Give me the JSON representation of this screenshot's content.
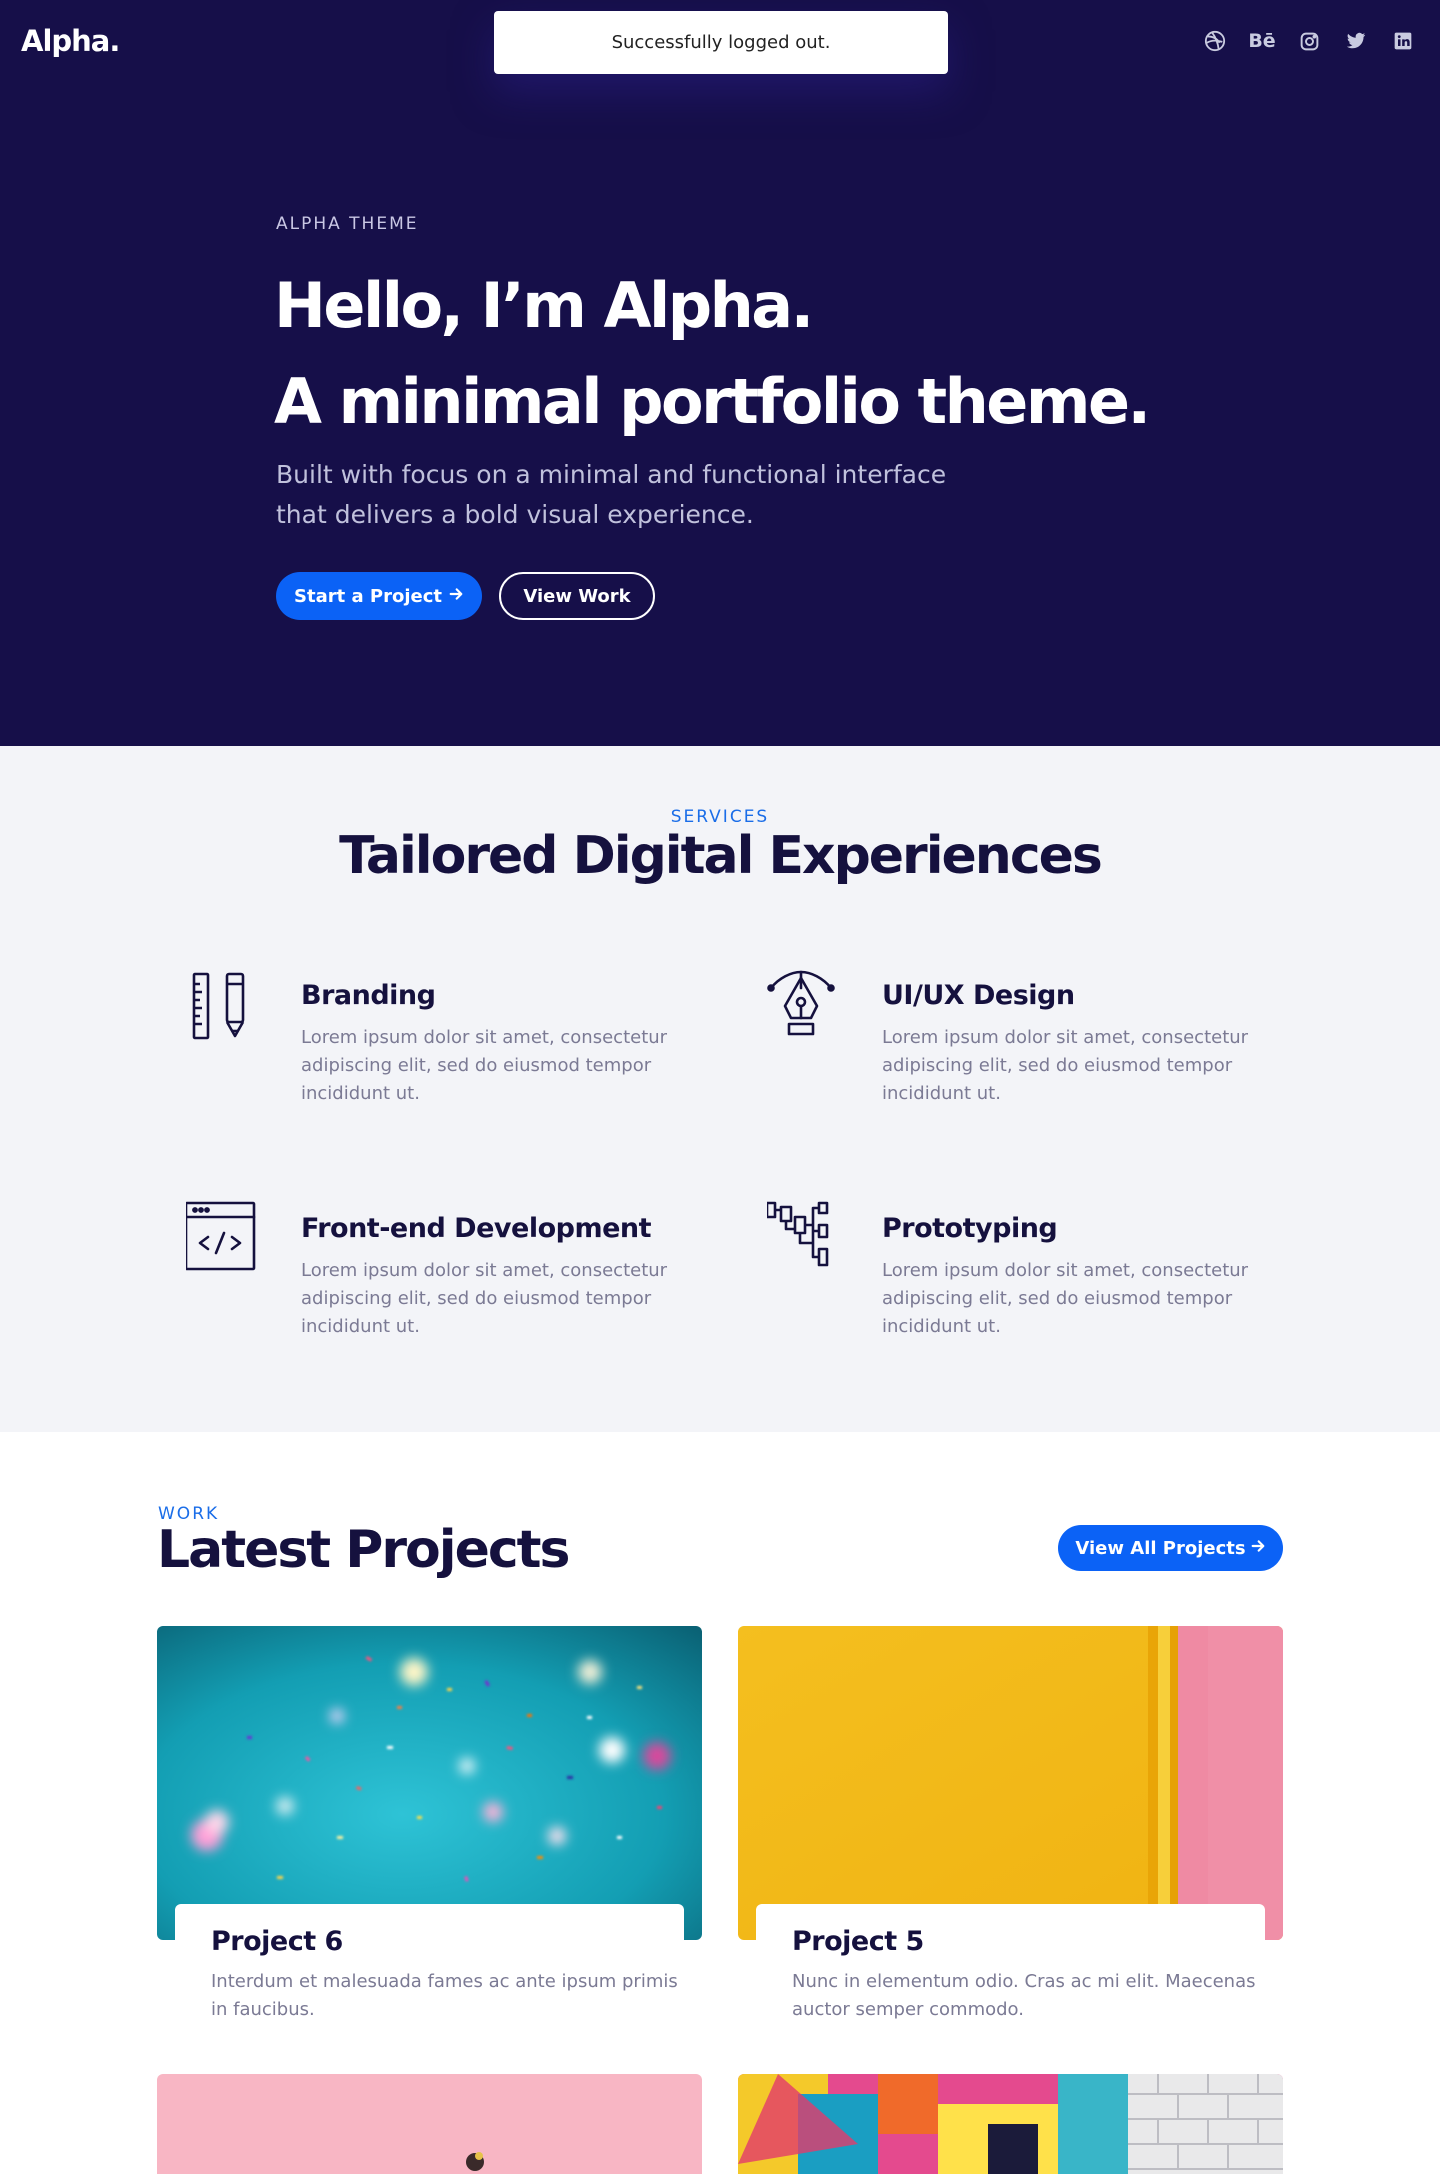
{
  "brand": {
    "logo": "Alpha."
  },
  "toast": {
    "message": "Successfully logged out."
  },
  "social_icons": [
    "dribbble-icon",
    "behance-icon",
    "instagram-icon",
    "twitter-icon",
    "linkedin-icon"
  ],
  "social_labels": {
    "behance": "Bē"
  },
  "hero": {
    "eyebrow": "ALPHA THEME",
    "title_line1": "Hello, I’m Alpha.",
    "title_line2": "A minimal portfolio theme.",
    "subtitle_line1": "Built with focus on a minimal and functional interface",
    "subtitle_line2": "that delivers a bold visual experience.",
    "primary_button": "Start a Project",
    "secondary_button": "View Work"
  },
  "services": {
    "eyebrow": "SERVICES",
    "title": "Tailored Digital Experiences",
    "items": [
      {
        "name": "Branding",
        "description": "Lorem ipsum dolor sit amet, consectetur adipiscing elit, sed do eiusmod tempor incididunt ut.",
        "icon": "ruler-pencil-icon"
      },
      {
        "name": "UI/UX Design",
        "description": "Lorem ipsum dolor sit amet, consectetur adipiscing elit, sed do eiusmod tempor incididunt ut.",
        "icon": "pen-tool-icon"
      },
      {
        "name": "Front-end Development",
        "description": "Lorem ipsum dolor sit amet, consectetur adipiscing elit, sed do eiusmod tempor incididunt ut.",
        "icon": "code-window-icon"
      },
      {
        "name": "Prototyping",
        "description": "Lorem ipsum dolor sit amet, consectetur adipiscing elit, sed do eiusmod tempor incididunt ut.",
        "icon": "flowchart-icon"
      }
    ]
  },
  "work": {
    "eyebrow": "WORK",
    "title": "Latest Projects",
    "view_all_button": "View All Projects",
    "projects": [
      {
        "title": "Project 6",
        "description": "Interdum et malesuada fames ac ante ipsum primis in faucibus."
      },
      {
        "title": "Project 5",
        "description": "Nunc in elementum odio. Cras ac mi elit. Maecenas auctor semper commodo."
      }
    ]
  },
  "colors": {
    "hero_bg": "#160f49",
    "accent": "#0b62f6",
    "services_bg": "#f3f4f8",
    "heading": "#15113e",
    "body_text": "#7b7a94"
  }
}
